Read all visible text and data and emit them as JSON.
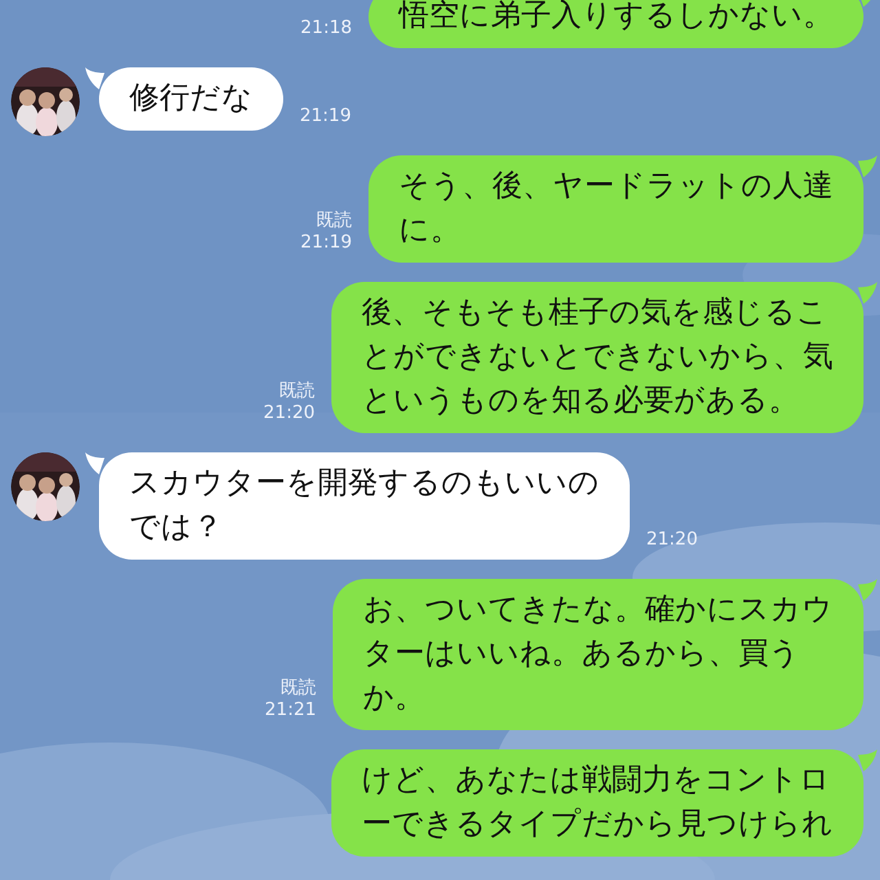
{
  "messages": [
    {
      "kind": "sent",
      "lines": [
        "悟空に弟子入りするしかない。"
      ],
      "time": "21:18"
    },
    {
      "kind": "received",
      "lines": [
        "修行だな"
      ],
      "time": "21:19"
    },
    {
      "kind": "sent",
      "lines": [
        "そう、後、ヤードラットの人達",
        "に。"
      ],
      "read": "既読",
      "time": "21:19"
    },
    {
      "kind": "sent",
      "lines": [
        "後、そもそも桂子の気を感じるこ",
        "とができないとできないから、気",
        "というものを知る必要がある。"
      ],
      "read": "既読",
      "time": "21:20"
    },
    {
      "kind": "received",
      "lines": [
        "スカウターを開発するのもいいの",
        "では？"
      ],
      "time": "21:20"
    },
    {
      "kind": "sent",
      "lines": [
        "お、ついてきたな。確かにスカウ",
        "ターはいいね。あるから、買う",
        "か。"
      ],
      "read": "既読",
      "time": "21:21"
    },
    {
      "kind": "sent",
      "lines": [
        "けど、あなたは戦闘力をコントロ",
        "ーできるタイプだから見つけられ"
      ]
    }
  ]
}
